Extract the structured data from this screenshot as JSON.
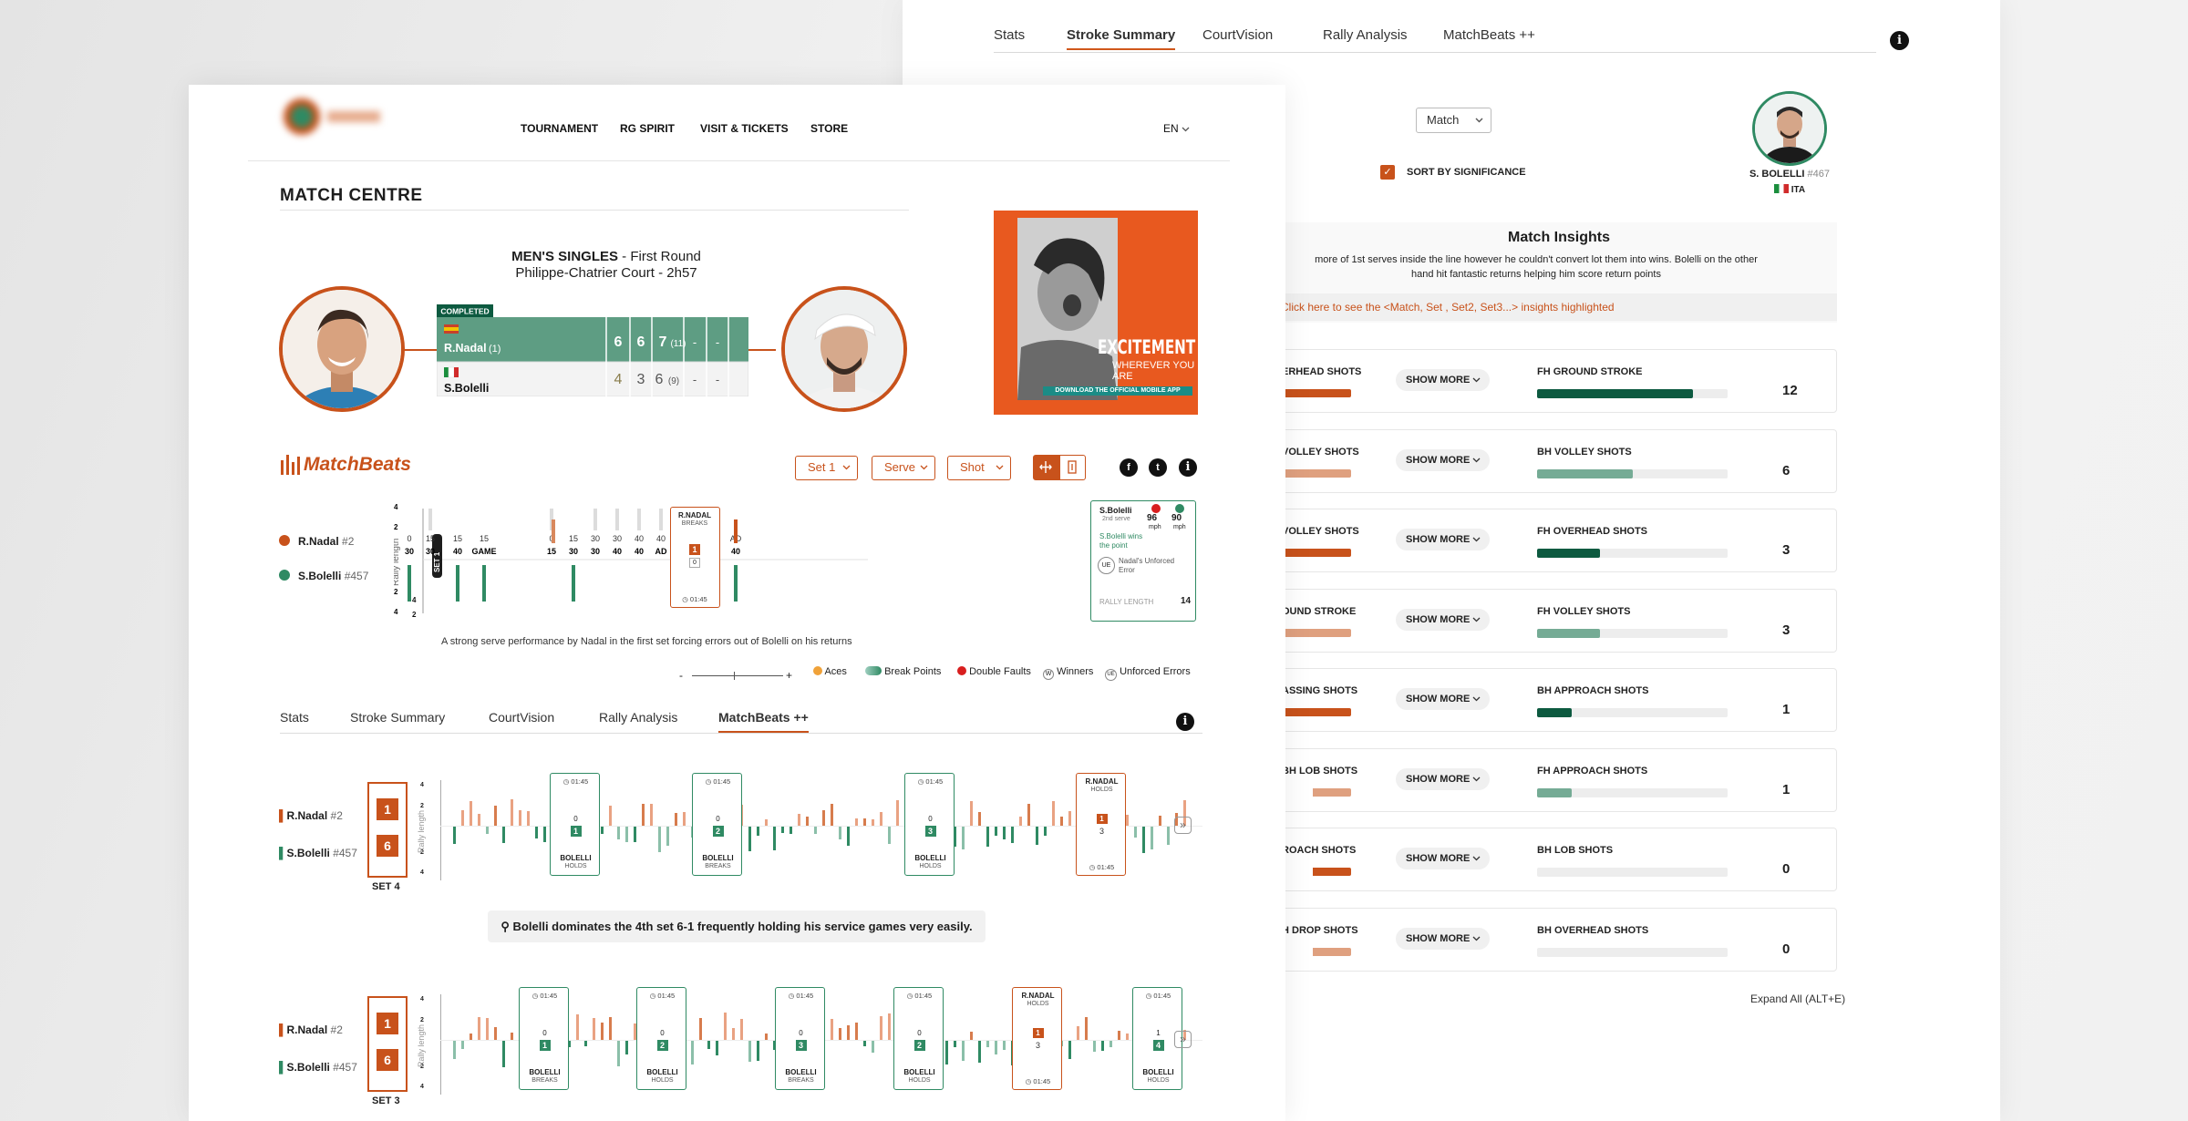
{
  "back": {
    "tabs": [
      {
        "label": "Stats",
        "active": false
      },
      {
        "label": "Stroke Summary",
        "active": true
      },
      {
        "label": "CourtVision",
        "active": false
      },
      {
        "label": "Rally Analysis",
        "active": false
      },
      {
        "label": "MatchBeats ++",
        "active": false
      }
    ],
    "filter_value": "Match",
    "sort_label": "SORT BY SIGNIFICANCE",
    "player": {
      "name": "S. BOLELLI",
      "rank": "#467",
      "country": "ITA"
    },
    "insights_title": "Match Insights",
    "insights_text_1": "more of 1st serves inside the line however he couldn't convert lot them into wins. Bolelli on the other",
    "insights_text_2": "hand hit fantastic returns helping him score return points",
    "insights_link": "Click here to see the <Match, Set , Set2, Set3...> insights highlighted",
    "show_more_label": "SHOW MORE",
    "rows": [
      {
        "left_label": "ERHEAD SHOTS",
        "left_fill": 1.0,
        "left_color": "#c8521b",
        "right_label": "FH GROUND STROKE",
        "right_fill": 0.82,
        "right_color": "#0d5a40",
        "value": "12"
      },
      {
        "left_label": "VOLLEY SHOTS",
        "left_fill": 1.0,
        "left_color": "#dfa07f",
        "right_label": "BH VOLLEY SHOTS",
        "right_fill": 0.5,
        "right_color": "#75ab95",
        "value": "6"
      },
      {
        "left_label": "VOLLEY SHOTS",
        "left_fill": 1.0,
        "left_color": "#c8521b",
        "right_label": "FH OVERHEAD SHOTS",
        "right_fill": 0.33,
        "right_color": "#0d5a40",
        "value": "3"
      },
      {
        "left_label": "OUND STROKE",
        "left_fill": 1.0,
        "left_color": "#dfa07f",
        "right_label": "FH VOLLEY SHOTS",
        "right_fill": 0.33,
        "right_color": "#75ab95",
        "value": "3"
      },
      {
        "left_label": "ASSING SHOTS",
        "left_fill": 1.0,
        "left_color": "#c8521b",
        "right_label": "BH APPROACH SHOTS",
        "right_fill": 0.18,
        "right_color": "#0d5a40",
        "value": "1"
      },
      {
        "left_label": "BH LOB SHOTS",
        "left_fill": 0.55,
        "left_color": "#dfa07f",
        "right_label": "FH APPROACH SHOTS",
        "right_fill": 0.18,
        "right_color": "#75ab95",
        "value": "1"
      },
      {
        "left_label": "ROACH SHOTS",
        "left_fill": 0.55,
        "left_color": "#c8521b",
        "right_label": "BH LOB SHOTS",
        "right_fill": 0,
        "right_color": "#0d5a40",
        "value": "0"
      },
      {
        "left_label": "H DROP SHOTS",
        "left_fill": 0.55,
        "left_color": "#dfa07f",
        "right_label": "BH OVERHEAD SHOTS",
        "right_fill": 0,
        "right_color": "#75ab95",
        "value": "0"
      }
    ],
    "expand_label": "Expand All (ALT+E)"
  },
  "front": {
    "nav": [
      "TOURNAMENT",
      "RG SPIRIT",
      "VISIT & TICKETS",
      "STORE"
    ],
    "lang": "EN",
    "title": "MATCH CENTRE",
    "match_event": "MEN'S SINGLES",
    "match_round": "First Round",
    "match_court": "Philippe-Chatrier Court - 2h57",
    "status": "COMPLETED",
    "players": [
      {
        "name": "R.Nadal",
        "seed": "(1)",
        "sets": [
          "6",
          "6",
          "7",
          "-",
          "-"
        ],
        "tiebreak": "(11)"
      },
      {
        "name": "S.Bolelli",
        "seed": "",
        "sets": [
          "4",
          "3",
          "6",
          "-",
          "-"
        ],
        "tiebreak": "(9)"
      }
    ],
    "ad": {
      "line1": "EXCITEMENT",
      "line2": "WHEREVER YOU ARE",
      "line3": "DOWNLOAD THE OFFICIAL MOBILE APP"
    },
    "matchbeats_title": "MatchBeats",
    "filters": [
      {
        "label": "Set 1"
      },
      {
        "label": "Serve"
      },
      {
        "label": "Shot"
      }
    ],
    "legend_players": [
      {
        "name": "R.Nadal",
        "rank": "#2",
        "color": "#c8521b"
      },
      {
        "name": "S.Bolelli",
        "rank": "#457",
        "color": "#2f8a63"
      }
    ],
    "rally_axis_label": "Rally length",
    "set_tag": "SET 1",
    "set1_points": [
      {
        "top": "0",
        "bot": "0"
      },
      {
        "top": "15",
        "bot": "0"
      },
      {
        "top": "30",
        "bot": "0"
      },
      {
        "top": "30",
        "bot": "15"
      },
      {
        "top": "40",
        "bot": "15"
      },
      {
        "top": "GAME",
        "bot": "15"
      },
      {
        "top": "15",
        "bot": "0"
      },
      {
        "top": "30",
        "bot": "15"
      },
      {
        "top": "30",
        "bot": "30"
      },
      {
        "top": "40",
        "bot": "30"
      },
      {
        "top": "40",
        "bot": "40"
      },
      {
        "top": "AD",
        "bot": "40"
      },
      {
        "top": "40",
        "bot": "40"
      },
      {
        "top": "AD",
        "bot": "40"
      },
      {
        "top": "40",
        "bot": "AD"
      }
    ],
    "nadal_break_card": {
      "name": "R.NADAL",
      "status": "BREAKS",
      "value": "1",
      "sub": "0",
      "time": "01:45"
    },
    "tooltip": {
      "player": "S.Bolelli",
      "serve": "2nd serve",
      "speed1": "96",
      "speed2": "90",
      "unit": "mph",
      "result": "S.Bolelli wins the point",
      "code": "UE",
      "error_text": "Nadal's Unforced Error",
      "rally_label": "RALLY LENGTH",
      "rally_value": "14"
    },
    "caption1": "A strong serve performance by Nadal  in the first set forcing errors out of Bolelli on his returns",
    "zoom_minus": "-",
    "zoom_plus": "+",
    "legend_items": [
      "Aces",
      "Break Points",
      "Double Faults",
      "Winners",
      "Unforced Errors"
    ],
    "legend_codes": [
      "W",
      "UE"
    ],
    "tabs": [
      {
        "label": "Stats",
        "active": false
      },
      {
        "label": "Stroke Summary",
        "active": false
      },
      {
        "label": "CourtVision",
        "active": false
      },
      {
        "label": "Rally Analysis",
        "active": false
      },
      {
        "label": "MatchBeats ++",
        "active": true
      }
    ],
    "set4": {
      "label": "SET 4",
      "nadal_games": "1",
      "bolelli_games": "6",
      "cards": [
        {
          "player": "BOLELLI",
          "status": "HOLDS",
          "games": "1",
          "sub": "0",
          "time": "01:45",
          "color": "green"
        },
        {
          "player": "BOLELLI",
          "status": "BREAKS",
          "games": "2",
          "sub": "0",
          "time": "01:45",
          "color": "green"
        },
        {
          "player": "BOLELLI",
          "status": "HOLDS",
          "games": "3",
          "sub": "0",
          "time": "01:45",
          "color": "green"
        },
        {
          "player": "R.NADAL",
          "status": "HOLDS",
          "games": "1",
          "sub": "3",
          "time": "01:45",
          "color": "orange"
        }
      ]
    },
    "banner": "Bolelli dominates the 4th set 6-1 frequently holding his service games very easily.",
    "set3": {
      "label": "SET 3",
      "nadal_games": "1",
      "bolelli_games": "6",
      "cards": [
        {
          "player": "BOLELLI",
          "status": "BREAKS",
          "games": "1",
          "sub": "0",
          "time": "01:45",
          "color": "green"
        },
        {
          "player": "BOLELLI",
          "status": "HOLDS",
          "games": "2",
          "sub": "0",
          "time": "01:45",
          "color": "green"
        },
        {
          "player": "BOLELLI",
          "status": "BREAKS",
          "games": "3",
          "sub": "0",
          "time": "01:45",
          "color": "green"
        },
        {
          "player": "BOLELLI",
          "status": "HOLDS",
          "games": "2",
          "sub": "0",
          "time": "01:45",
          "color": "green"
        },
        {
          "player": "R.NADAL",
          "status": "HOLDS",
          "games": "1",
          "sub": "3",
          "time": "01:45",
          "color": "orange"
        },
        {
          "player": "BOLELLI",
          "status": "HOLDS",
          "games": "4",
          "sub": "1",
          "time": "01:45",
          "color": "green"
        }
      ]
    },
    "small_rows": [
      {
        "name": "R.Nadal",
        "rank": "#2"
      },
      {
        "name": "S.Bolelli",
        "rank": "#457"
      }
    ],
    "colors": {
      "accent": "#c8521b",
      "green": "#2f8a63",
      "dark_green": "#0d5a40"
    }
  }
}
